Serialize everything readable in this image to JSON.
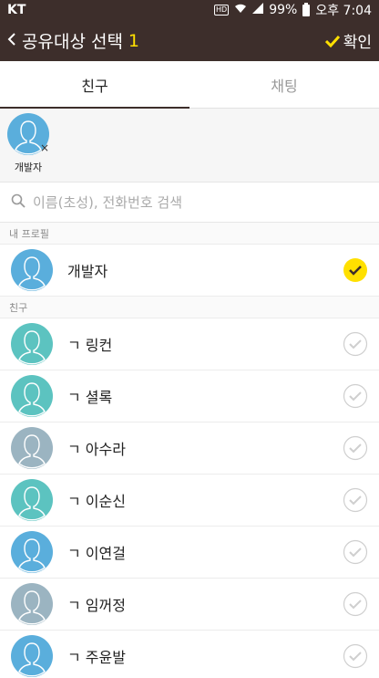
{
  "status_bar": {
    "carrier": "KT",
    "hd": "HD",
    "battery": "99%",
    "time": "오후 7:04"
  },
  "app_bar": {
    "title": "공유대상 선택",
    "count": "1",
    "confirm_label": "확인"
  },
  "tabs": [
    {
      "label": "친구",
      "active": true
    },
    {
      "label": "채팅",
      "active": false
    }
  ],
  "selected": [
    {
      "name": "개발자",
      "remove": "×",
      "color": "#5aaedc"
    }
  ],
  "search": {
    "placeholder": "이름(초성), 전화번호 검색"
  },
  "my_profile": {
    "header": "내 프로필",
    "name": "개발자",
    "color": "#5aaedc",
    "checked": true
  },
  "friends": {
    "header": "친구",
    "items": [
      {
        "name": "ㄱ 링컨",
        "color": "#5cc3c0"
      },
      {
        "name": "ㄱ 셜록",
        "color": "#5cc3c0"
      },
      {
        "name": "ㄱ 아수라",
        "color": "#9bb4c1"
      },
      {
        "name": "ㄱ 이순신",
        "color": "#5cc3c0"
      },
      {
        "name": "ㄱ 이연걸",
        "color": "#5aaedc"
      },
      {
        "name": "ㄱ 임꺼정",
        "color": "#9bb4c1"
      },
      {
        "name": "ㄱ 주윤발",
        "color": "#5aaedc"
      }
    ]
  },
  "colors": {
    "bar": "#3d2e2b",
    "accent": "#ffe000",
    "check_selected": "#ffe000"
  }
}
